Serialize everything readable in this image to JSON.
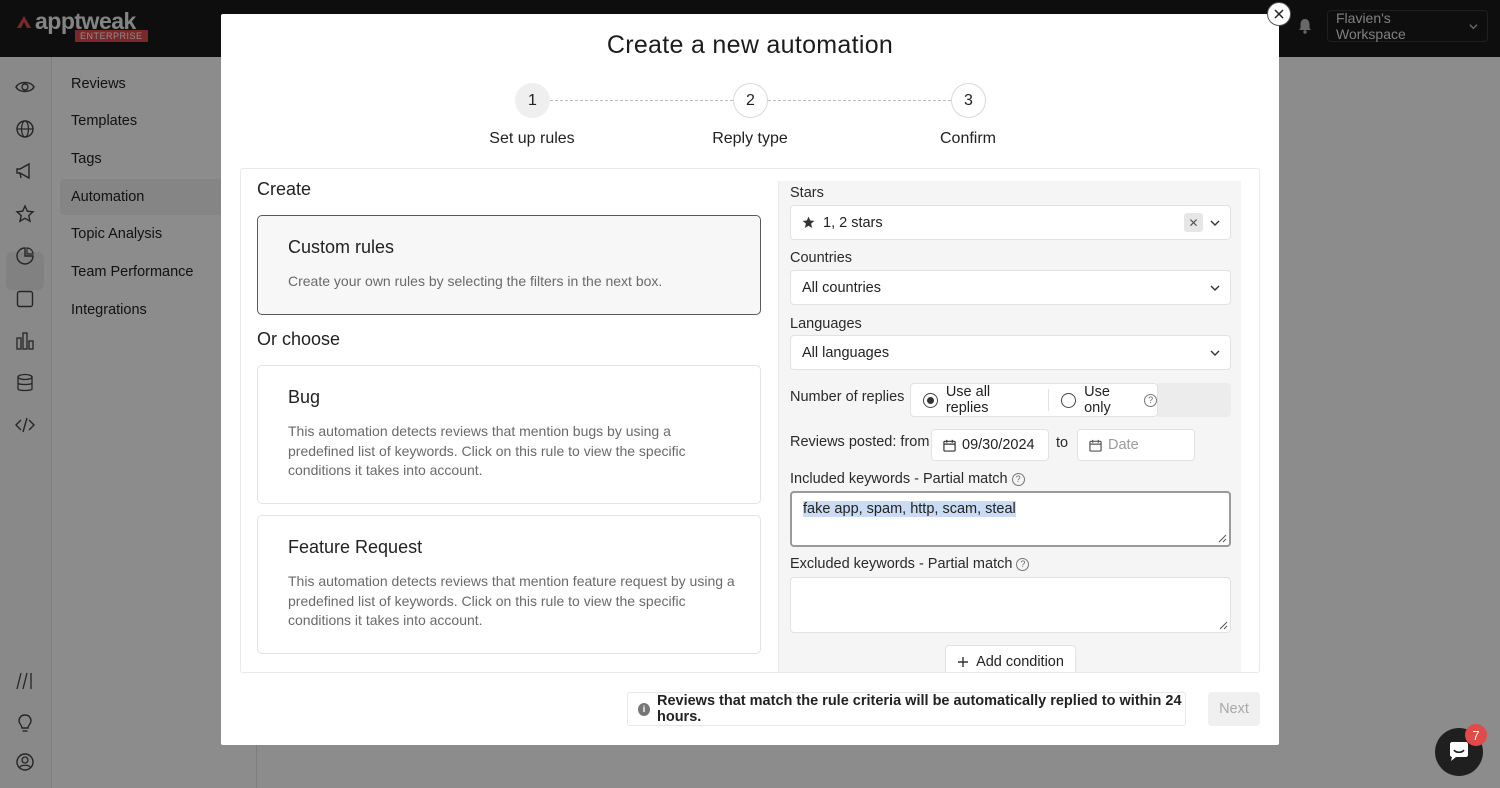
{
  "app": {
    "logo_text": "apptweak",
    "logo_badge": "ENTERPRISE",
    "workspace_label": "Flavien's Workspace"
  },
  "subnav": {
    "items": [
      {
        "label": "Reviews"
      },
      {
        "label": "Templates"
      },
      {
        "label": "Tags"
      },
      {
        "label": "Automation"
      },
      {
        "label": "Topic Analysis"
      },
      {
        "label": "Team Performance"
      },
      {
        "label": "Integrations"
      }
    ],
    "active": "Automation"
  },
  "rail_icons": [
    "eye-icon",
    "globe-icon",
    "megaphone-icon",
    "star-icon",
    "pie-chart-icon",
    "square-icon",
    "bar-chart-icon",
    "database-icon",
    "code-icon",
    "slashes-icon",
    "bulb-icon",
    "user-circle-icon"
  ],
  "modal": {
    "title": "Create a new automation",
    "steps": [
      {
        "number": "1",
        "label": "Set up rules",
        "active": true
      },
      {
        "number": "2",
        "label": "Reply type",
        "active": false
      },
      {
        "number": "3",
        "label": "Confirm",
        "active": false
      }
    ],
    "left": {
      "create_heading": "Create",
      "custom_card": {
        "title": "Custom rules",
        "desc": "Create your own rules by selecting the filters in the next box."
      },
      "choose_heading": "Or choose",
      "bug_card": {
        "title": "Bug",
        "desc": "This automation detects reviews that mention bugs by using a predefined list of keywords. Click on this rule to view the specific conditions it takes into account."
      },
      "feature_card": {
        "title": "Feature Request",
        "desc": "This automation detects reviews that mention feature request by using a predefined list of keywords. Click on this rule to view the specific conditions it takes into account."
      }
    },
    "filters": {
      "stars_label": "Stars",
      "stars_value": "1, 2 stars",
      "countries_label": "Countries",
      "countries_value": "All countries",
      "languages_label": "Languages",
      "languages_value": "All languages",
      "replies_label": "Number of replies",
      "replies_option_all": "Use all replies",
      "replies_option_only": "Use only",
      "replies_selected": "Use all replies",
      "posted_label": "Reviews posted: from",
      "date_from": "09/30/2024",
      "to_label": "to",
      "date_to_placeholder": "Date",
      "included_label": "Included keywords - Partial match",
      "included_value": "fake app, spam, http, scam, steal",
      "excluded_label": "Excluded keywords - Partial match",
      "excluded_value": "",
      "add_condition": "Add condition"
    },
    "info_text": "Reviews that match the rule criteria will be automatically replied to within 24 hours.",
    "next_label": "Next"
  },
  "chat": {
    "badge_count": "7"
  },
  "colors": {
    "accent_red": "#e04a4a",
    "topbar": "#1b1b1b",
    "selection": "#c9dcf3"
  }
}
